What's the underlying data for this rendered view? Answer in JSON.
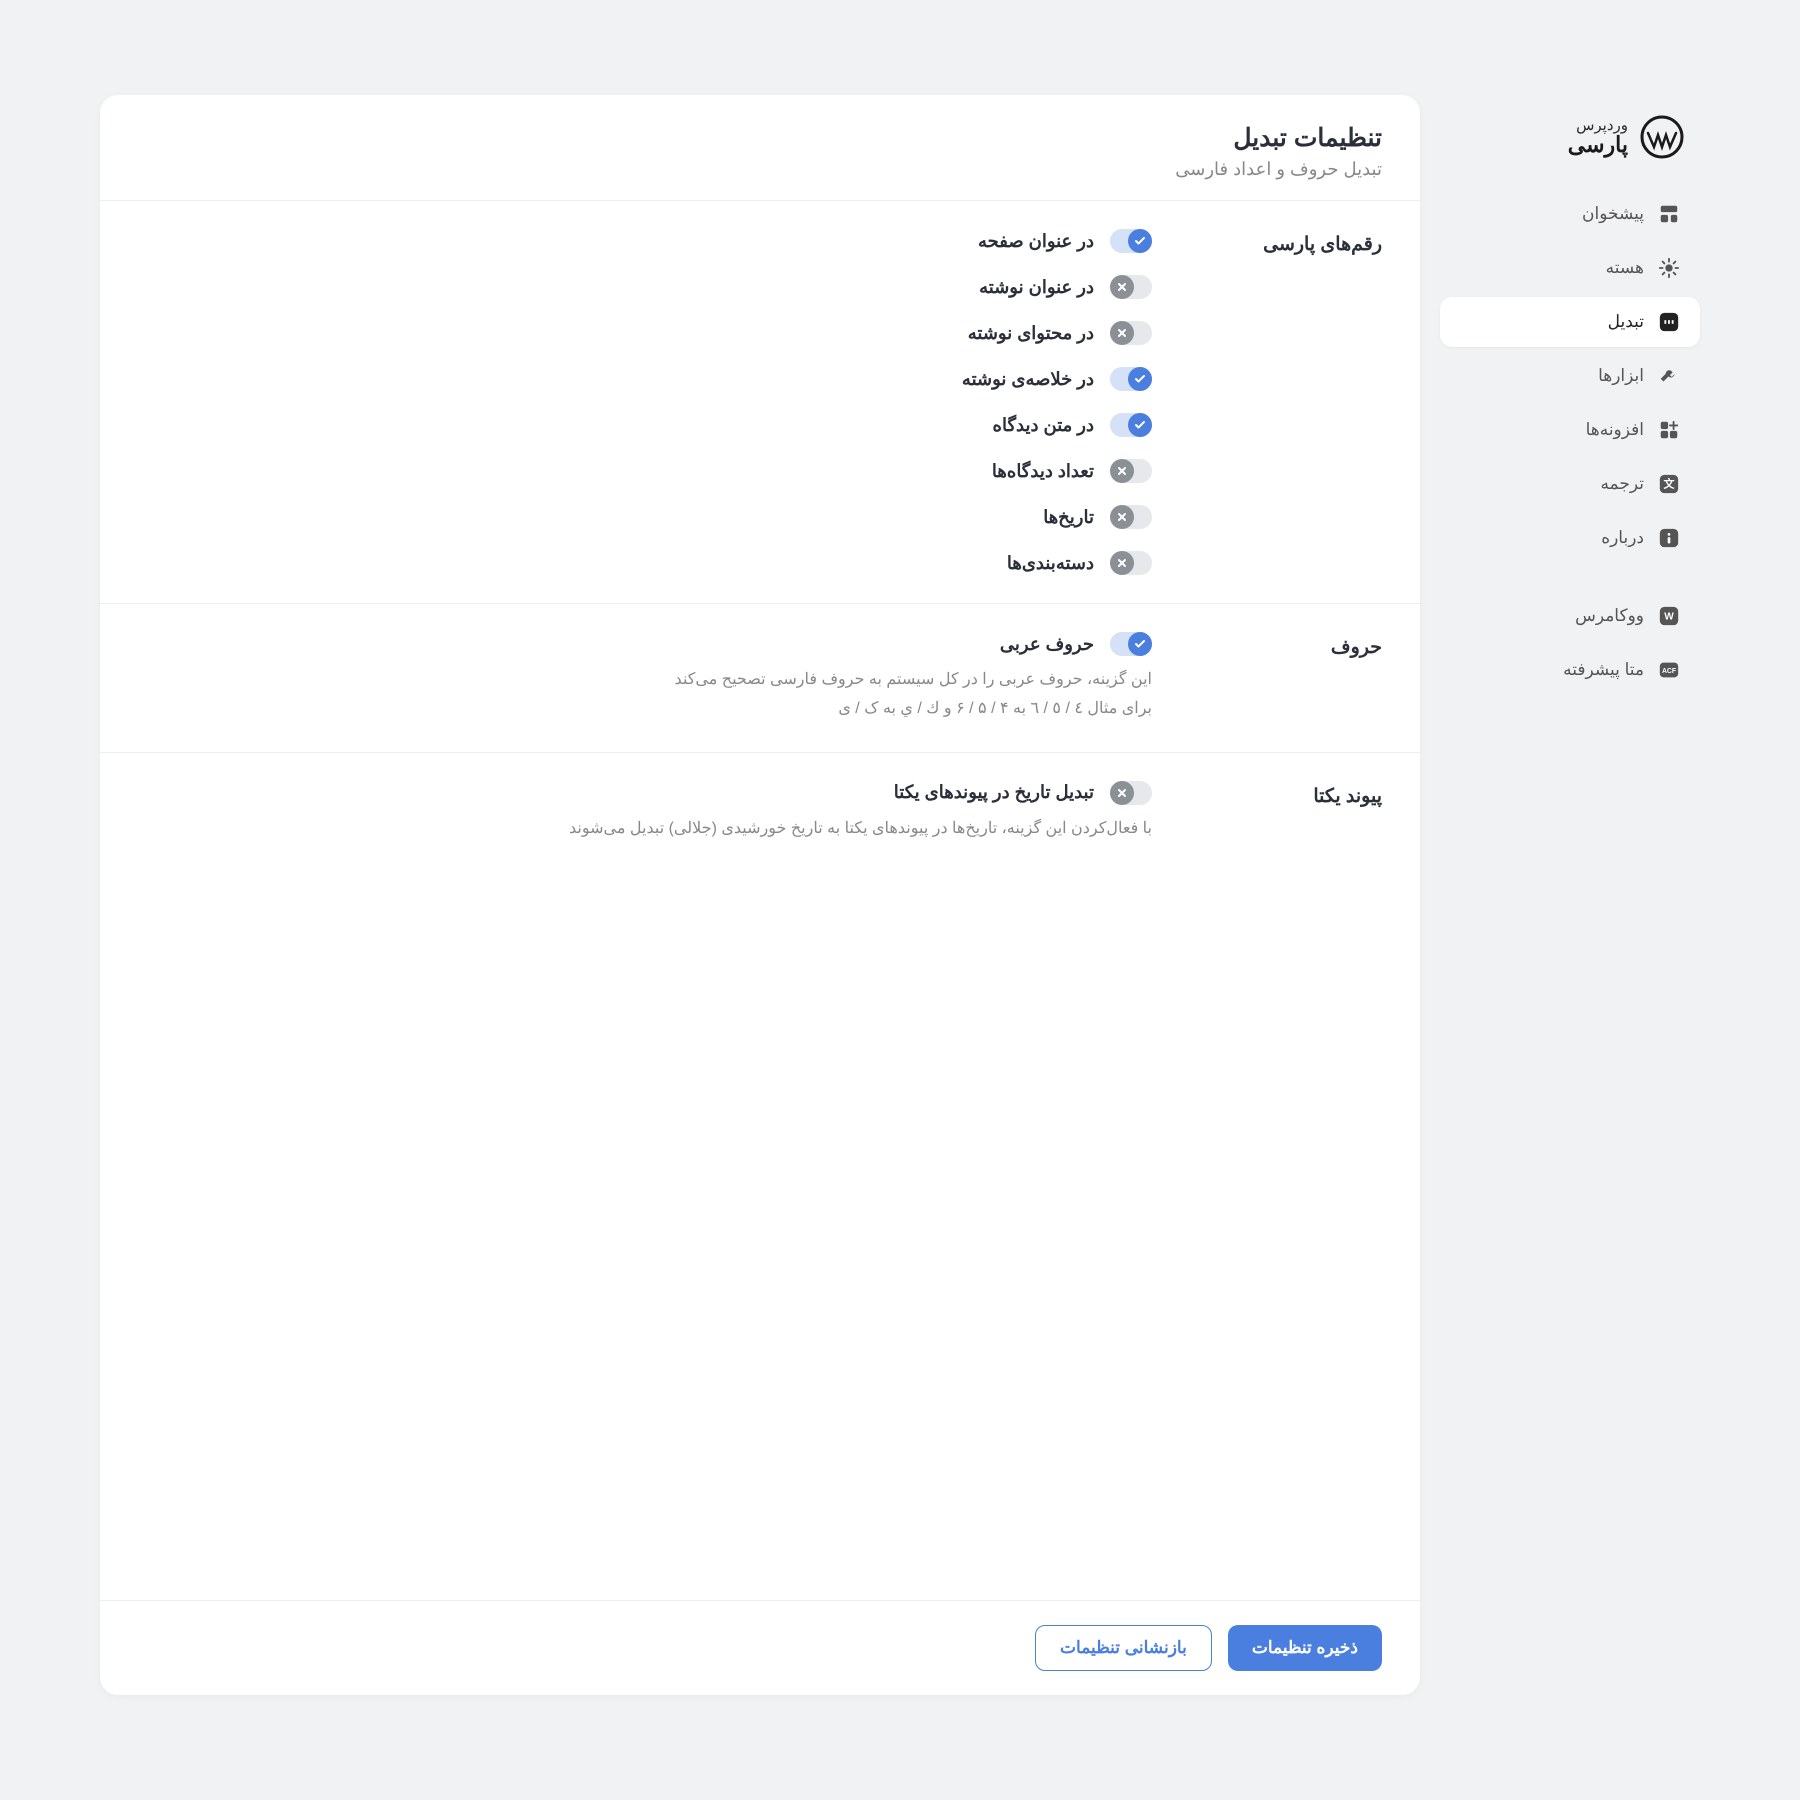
{
  "logo": {
    "top": "وردپرس",
    "bottom": "پارسی"
  },
  "nav": {
    "dashboard": "پیشخوان",
    "core": "هسته",
    "convert": "تبدیل",
    "tools": "ابزارها",
    "addons": "افزونه‌ها",
    "translate": "ترجمه",
    "about": "درباره",
    "woocommerce": "ووکامرس",
    "acf": "متا پیشرفته"
  },
  "header": {
    "title": "تنظیمات تبدیل",
    "subtitle": "تبدیل حروف و اعداد فارسی"
  },
  "sections": {
    "digits": {
      "label": "رقم‌های پارسی",
      "items": [
        {
          "label": "در عنوان صفحه",
          "on": true
        },
        {
          "label": "در عنوان نوشته",
          "on": false
        },
        {
          "label": "در محتوای نوشته",
          "on": false
        },
        {
          "label": "در خلاصه‌ی نوشته",
          "on": true
        },
        {
          "label": "در متن دیدگاه",
          "on": true
        },
        {
          "label": "تعداد دیدگاه‌ها",
          "on": false
        },
        {
          "label": "تاریخ‌ها",
          "on": false
        },
        {
          "label": "دسته‌بندی‌ها",
          "on": false
        }
      ]
    },
    "letters": {
      "label": "حروف",
      "items": [
        {
          "label": "حروف عربی",
          "on": true
        }
      ],
      "desc1": "این گزینه، حروف عربی را در کل سیستم به حروف فارسی تصحیح می‌کند",
      "desc2": "برای مثال ٤ / ٥ / ٦ به ۴ / ۵ / ۶ و ك / ي به ک / ی"
    },
    "permalink": {
      "label": "پیوند یکتا",
      "items": [
        {
          "label": "تبدیل تاریخ در پیوندهای یکتا",
          "on": false
        }
      ],
      "desc": "با فعال‌کردن این گزینه، تاریخ‌ها در پیوندهای یکتا به تاریخ خورشیدی (جلالی) تبدیل می‌شوند"
    }
  },
  "footer": {
    "save": "ذخیره تنظیمات",
    "reset": "بازنشانی تنظیمات"
  },
  "acf_badge": "ACF"
}
